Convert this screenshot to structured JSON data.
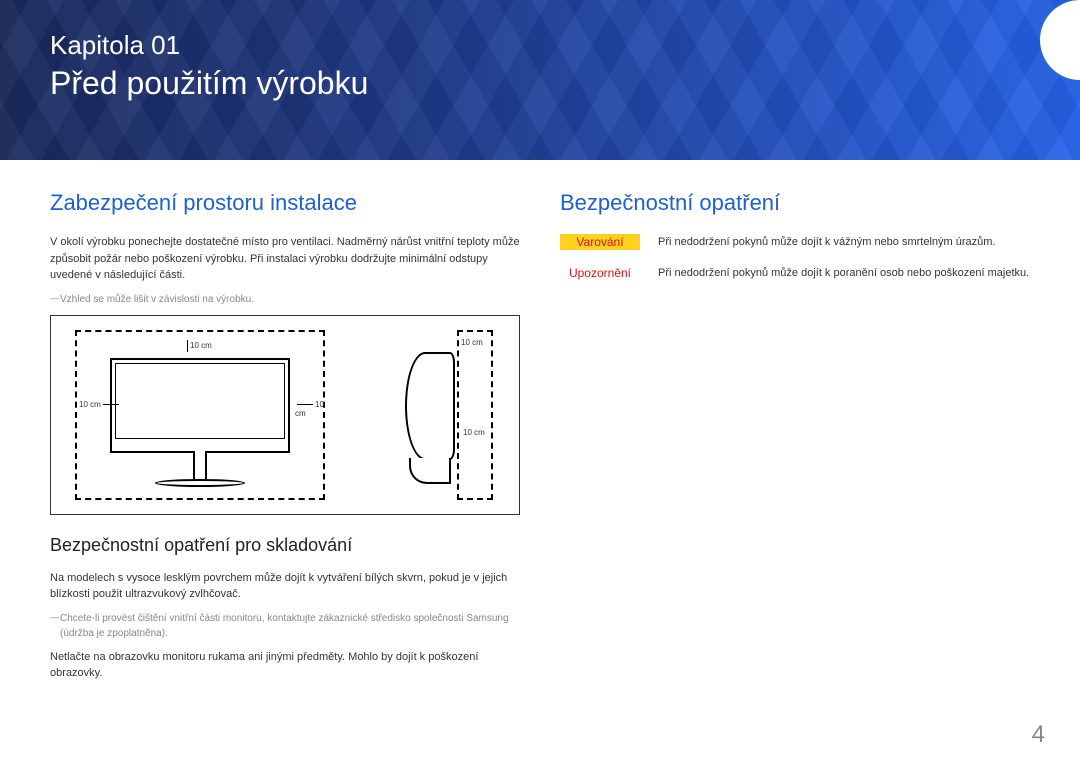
{
  "banner": {
    "chapter_num": "Kapitola 01",
    "chapter_title": "Před použitím výrobku"
  },
  "left": {
    "h2": "Zabezpečení prostoru instalace",
    "para1": "V okolí výrobku ponechejte dostatečné místo pro ventilaci. Nadměrný nárůst vnitřní teploty může způsobit požár nebo poškození výrobku. Při instalaci výrobku dodržujte minimální odstupy uvedené v následující části.",
    "note1": "Vzhled se může lišit v závislosti na výrobku.",
    "dim_10cm": "10 cm",
    "h3": "Bezpečnostní opatření pro skladování",
    "para2": "Na modelech s vysoce lesklým povrchem může dojít k vytváření bílých skvrn, pokud je v jejich blízkosti použit ultrazvukový zvlhčovač.",
    "note2": "Chcete-li provést čištění vnitřní části monitoru, kontaktujte zákaznické středisko společnosti Samsung (údržba je zpoplatněna).",
    "para3": "Netlačte na obrazovku monitoru rukama ani jinými předměty. Mohlo by dojít k poškození obrazovky."
  },
  "right": {
    "h2": "Bezpečnostní opatření",
    "rows": [
      {
        "label": "Varování",
        "text": "Při nedodržení pokynů může dojít k vážným nebo smrtelným úrazům."
      },
      {
        "label": "Upozornění",
        "text": "Při nedodržení pokynů může dojít k poranění osob nebo poškození majetku."
      }
    ]
  },
  "page_number": "4"
}
